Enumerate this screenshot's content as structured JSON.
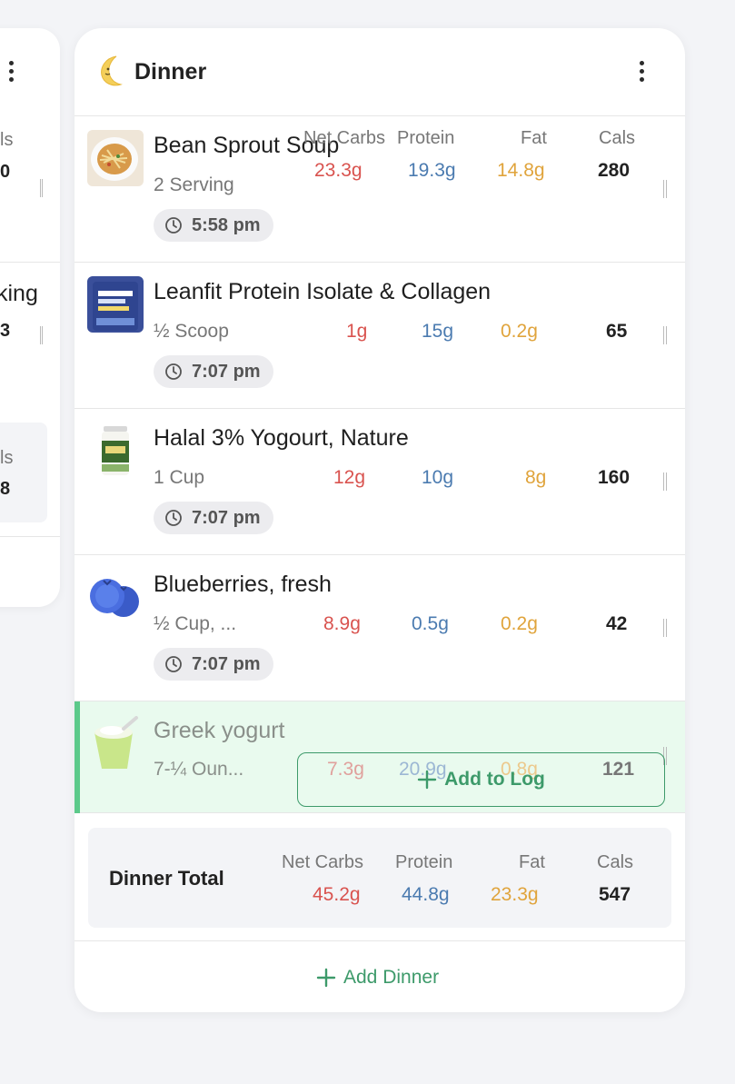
{
  "left_card": {
    "header_cal_partial": "ls",
    "row1_value_partial": "0",
    "row2_name_partial": "king",
    "row2_value_partial": "3",
    "total_header_partial": "ls",
    "total_value_partial": "8"
  },
  "meal": {
    "title": "Dinner",
    "icon": "moon-icon",
    "headers": {
      "carbs": "Net Carbs",
      "protein": "Protein",
      "fat": "Fat",
      "cals": "Cals"
    }
  },
  "items": [
    {
      "name": "Bean Sprout Soup",
      "serving": "2 Serving",
      "carbs": "23.3g",
      "protein": "19.3g",
      "fat": "14.8g",
      "cals": "280",
      "time": "5:58 pm",
      "icon": "soup-bowl-icon"
    },
    {
      "name": "Leanfit Protein Isolate & Collagen",
      "serving": "½ Scoop",
      "carbs": "1g",
      "protein": "15g",
      "fat": "0.2g",
      "cals": "65",
      "time": "7:07 pm",
      "icon": "protein-bag-icon"
    },
    {
      "name": "Halal 3% Yogourt, Nature",
      "serving": "1 Cup",
      "carbs": "12g",
      "protein": "10g",
      "fat": "8g",
      "cals": "160",
      "time": "7:07 pm",
      "icon": "yogurt-jar-icon"
    },
    {
      "name": "Blueberries, fresh",
      "serving": "½ Cup, ...",
      "carbs": "8.9g",
      "protein": "0.5g",
      "fat": "0.2g",
      "cals": "42",
      "time": "7:07 pm",
      "icon": "blueberry-icon"
    }
  ],
  "suggestion": {
    "name": "Greek yogurt",
    "serving": "7-¼ Oun...",
    "carbs": "7.3g",
    "protein": "20.9g",
    "fat": "0.8g",
    "cals": "121",
    "icon": "yogurt-cup-icon",
    "button_label": "Add to Log"
  },
  "total": {
    "label": "Dinner Total",
    "carbs": "45.2g",
    "protein": "44.8g",
    "fat": "23.3g",
    "cals": "547"
  },
  "add_button": "Add Dinner",
  "colors": {
    "carbs": "#d9534f",
    "protein": "#4b7bb0",
    "fat": "#e0a43c",
    "accent": "#3d9a6a"
  }
}
